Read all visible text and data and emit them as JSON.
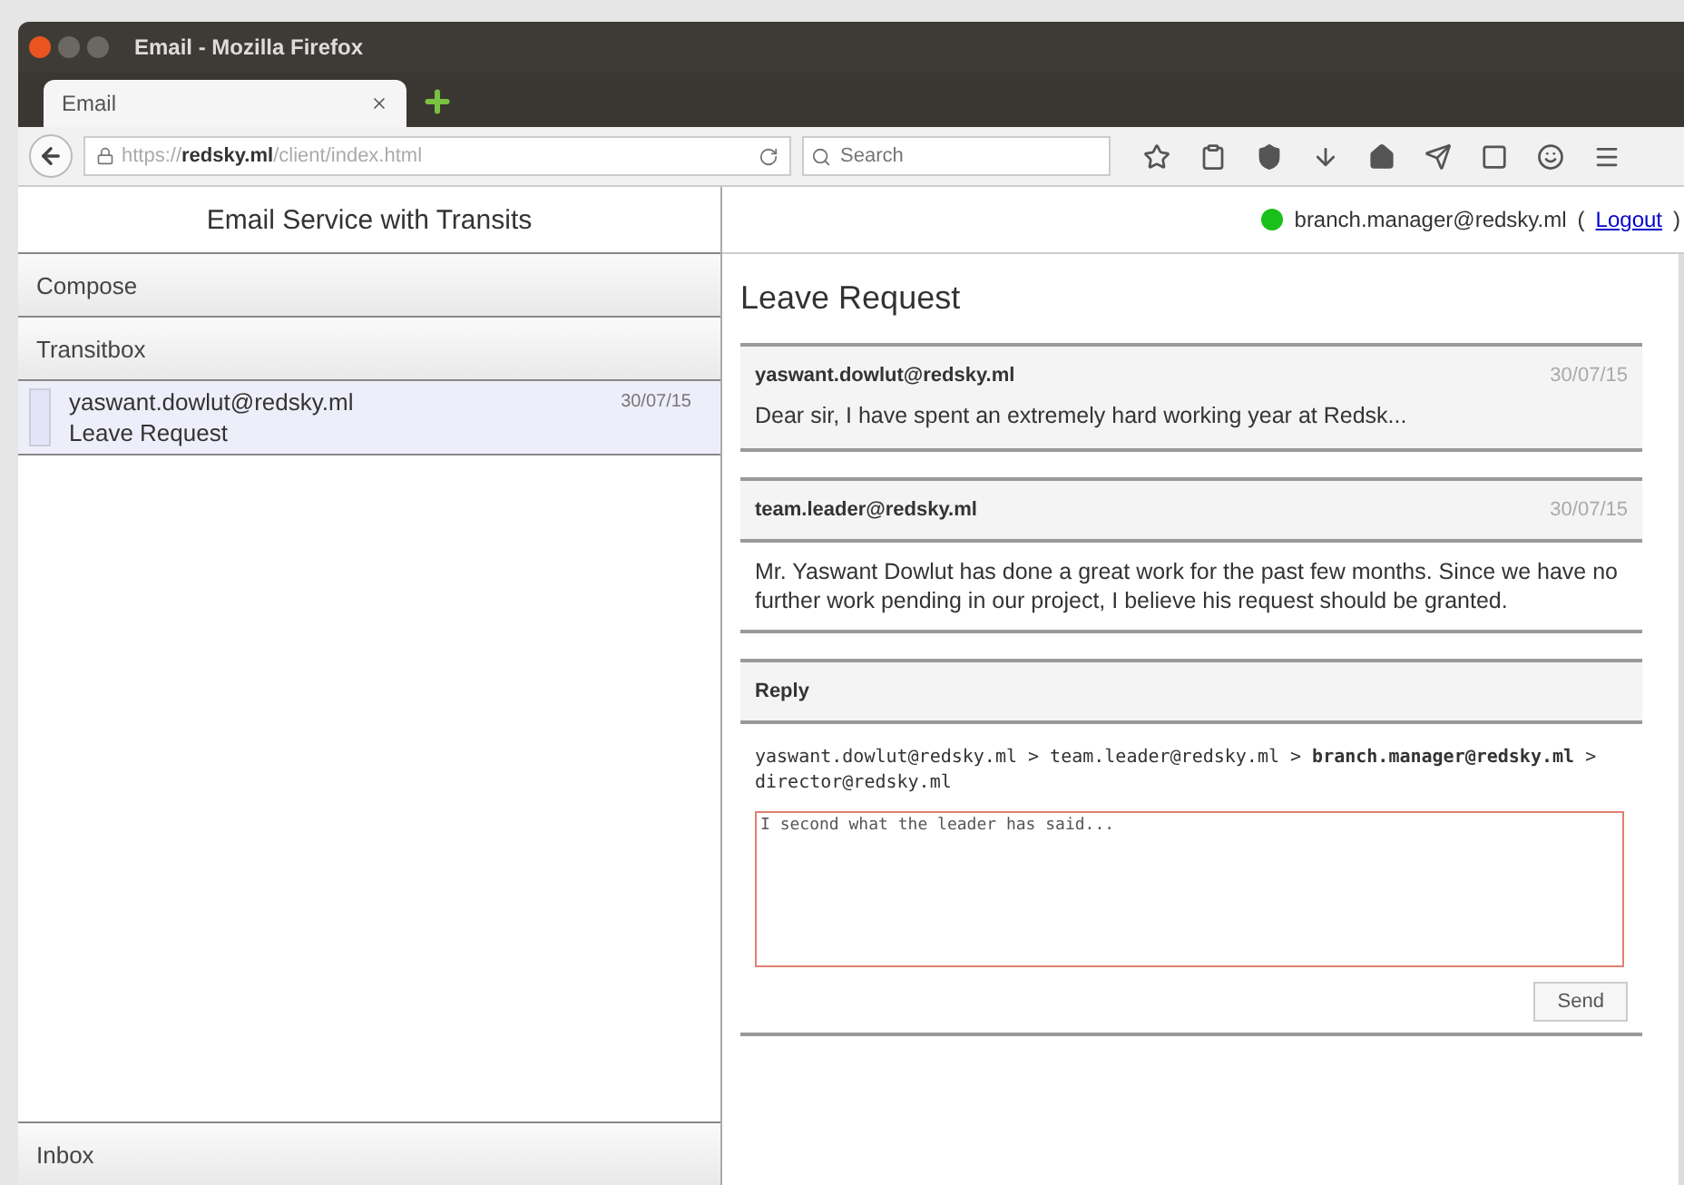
{
  "window": {
    "title": "Email - Mozilla Firefox"
  },
  "tabs": [
    {
      "label": "Email",
      "selected": true
    }
  ],
  "address_bar": {
    "url": "https://**redsky.ml**/client/index.html"
  },
  "search": {
    "placeholder": "Search"
  },
  "sidebar": {
    "title": "Email Service with Transits",
    "sections": [
      {
        "label": "Compose"
      },
      {
        "label": "Transitbox"
      }
    ],
    "items": [
      {
        "from": "yaswant.dowlut@redsky.ml",
        "subject": "Leave Request",
        "date": "30/07/15",
        "selected": true
      }
    ],
    "footer_section": {
      "label": "Inbox"
    }
  },
  "user": {
    "email": "branch.manager@redsky.ml",
    "online": true,
    "logout_open": "(",
    "logout": "Logout",
    "logout_close": ")"
  },
  "thread": {
    "title": "Leave Request",
    "messages": [
      {
        "from": "yaswant.dowlut@redsky.ml",
        "date": "30/07/15",
        "body": "Dear sir, I have spent an extremely hard working year at Redsk...",
        "expanded": false
      },
      {
        "from": "team.leader@redsky.ml",
        "date": "30/07/15",
        "body": "Mr. Yaswant Dowlut has done a great work for the past few months. Since we have no further work pending in our project, I believe his request should be granted.",
        "expanded": true
      }
    ],
    "reply": {
      "title": "Reply",
      "route": "yaswant.dowlut@redsky.ml > team.leader@redsky.ml > **branch.manager@redsky.ml** > director@redsky.ml",
      "value": "I second what the leader has said...",
      "send": "Send"
    }
  }
}
